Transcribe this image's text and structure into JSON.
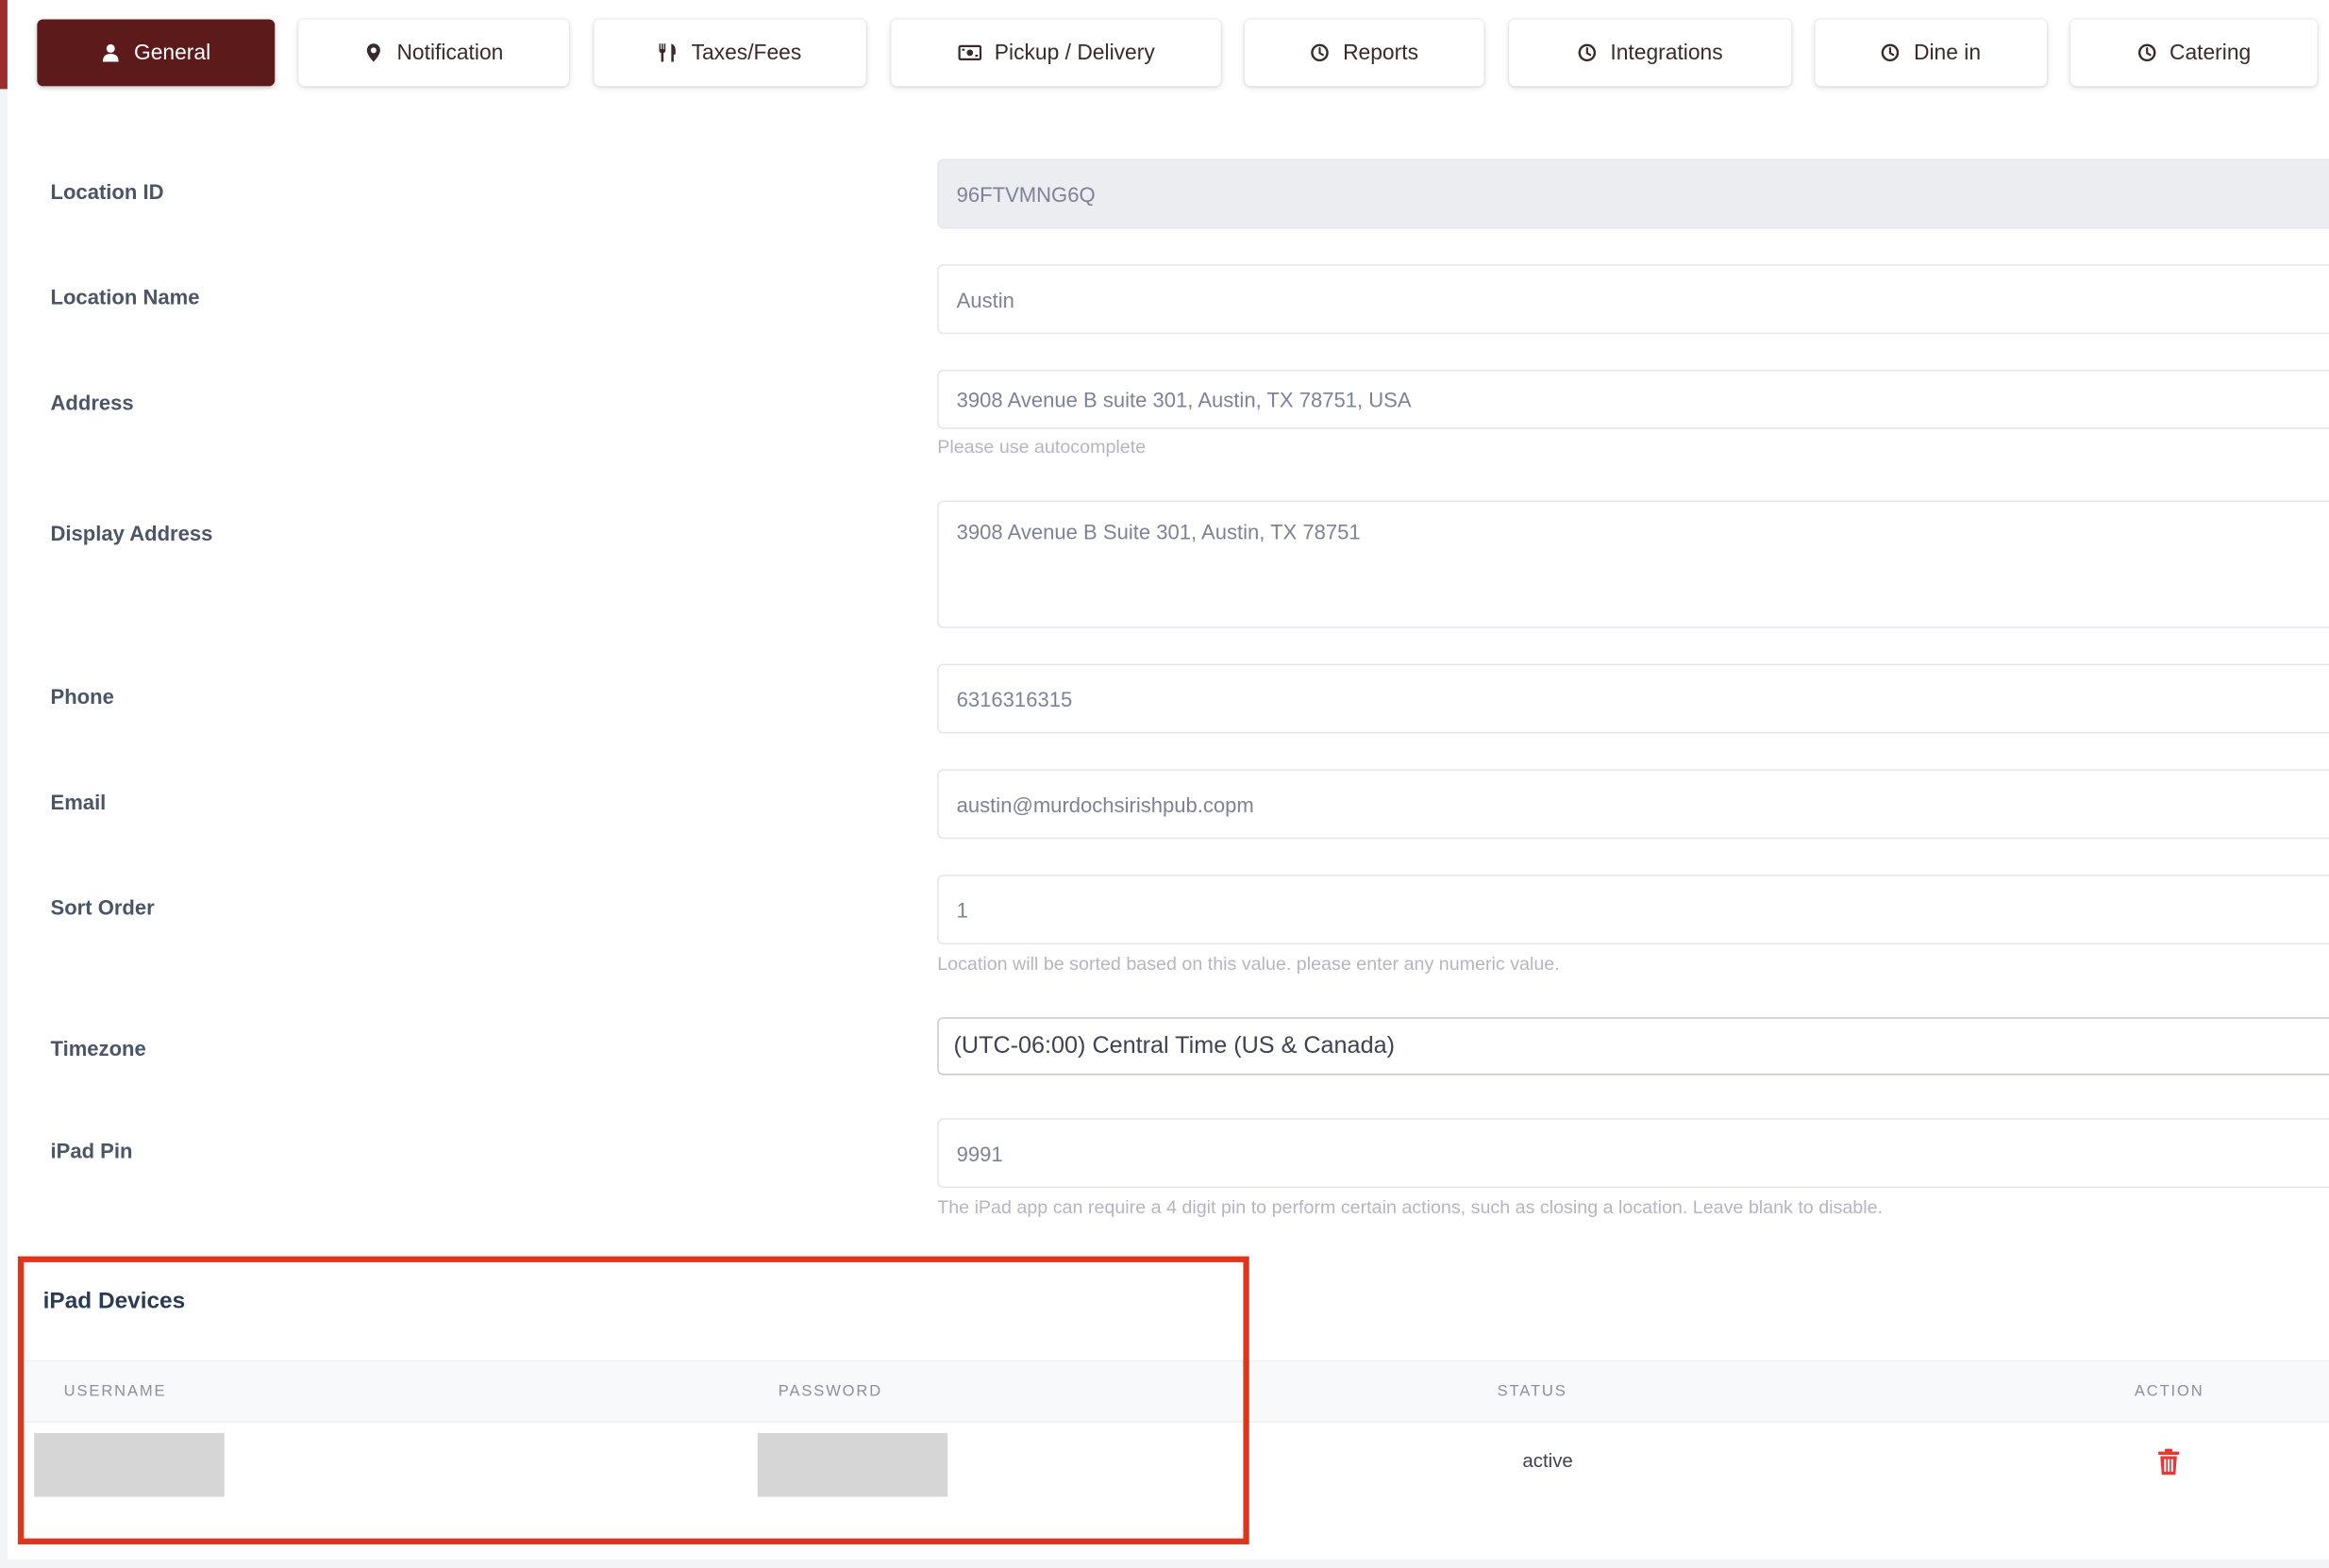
{
  "tabs": [
    {
      "label": "General",
      "icon": "user-icon",
      "active": true
    },
    {
      "label": "Notification",
      "icon": "map-pin-icon"
    },
    {
      "label": "Taxes/Fees",
      "icon": "utensils-icon"
    },
    {
      "label": "Pickup / Delivery",
      "icon": "money-bill-icon"
    },
    {
      "label": "Reports",
      "icon": "clock-icon"
    },
    {
      "label": "Integrations",
      "icon": "clock-icon"
    },
    {
      "label": "Dine in",
      "icon": "clock-icon"
    },
    {
      "label": "Catering",
      "icon": "clock-icon"
    }
  ],
  "form": {
    "location_id": {
      "label": "Location ID",
      "value": "96FTVMNG6Q"
    },
    "location_name": {
      "label": "Location Name",
      "value": "Austin"
    },
    "address": {
      "label": "Address",
      "value": "3908 Avenue B suite 301, Austin, TX 78751, USA",
      "hint": "Please use autocomplete"
    },
    "display_address": {
      "label": "Display Address",
      "value": "3908 Avenue B Suite 301, Austin, TX 78751"
    },
    "phone": {
      "label": "Phone",
      "value": "6316316315"
    },
    "email": {
      "label": "Email",
      "value": "austin@murdochsirishpub.copm"
    },
    "sort_order": {
      "label": "Sort Order",
      "value": "1",
      "hint": "Location will be sorted based on this value. please enter any numeric value."
    },
    "timezone": {
      "label": "Timezone",
      "value": "(UTC-06:00) Central Time (US & Canada)"
    },
    "ipad_pin": {
      "label": "iPad Pin",
      "value": "9991",
      "hint": "The iPad app can require a 4 digit pin to perform certain actions, such as closing a location. Leave blank to disable."
    }
  },
  "ipad_devices": {
    "title": "iPad Devices",
    "columns": [
      "USERNAME",
      "PASSWORD",
      "STATUS",
      "ACTION"
    ],
    "rows": [
      {
        "status": "active"
      }
    ]
  },
  "colors": {
    "active_tab": "#5c1a1a",
    "highlight": "#e0341d",
    "trash": "#e53935"
  }
}
